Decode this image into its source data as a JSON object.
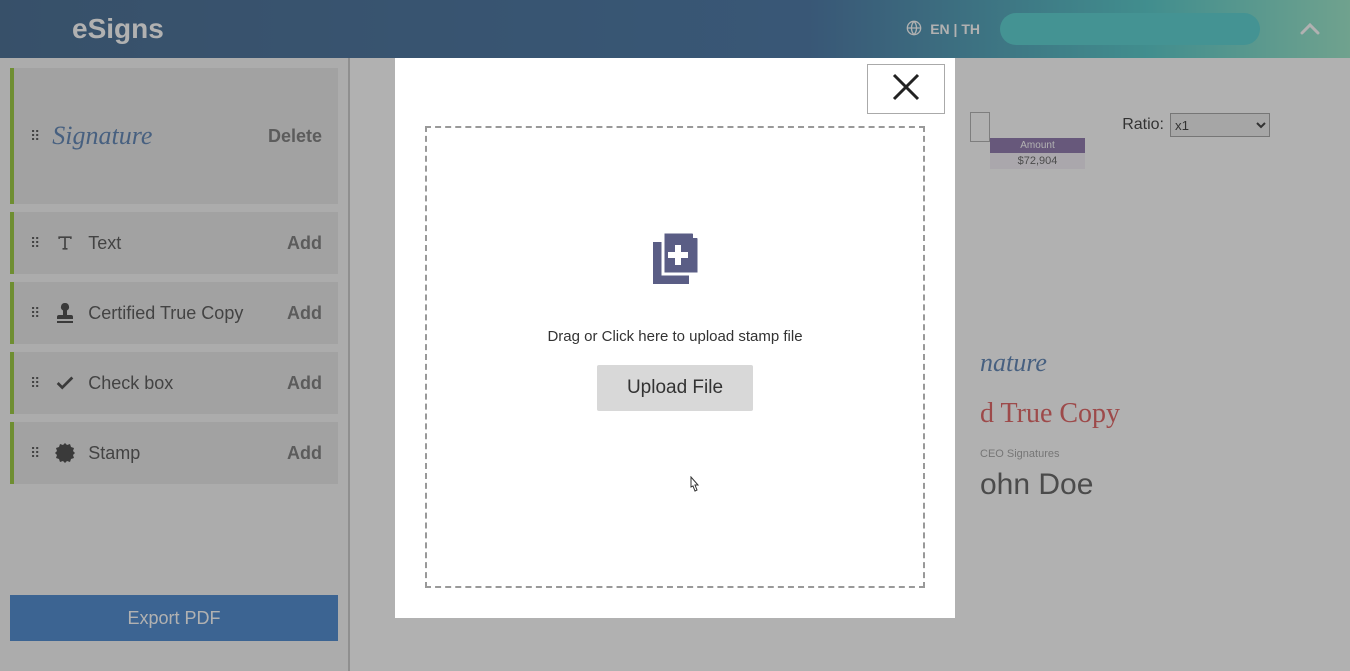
{
  "header": {
    "logo": "eSigns",
    "lang": "EN | TH"
  },
  "sidebar": {
    "items": [
      {
        "label": "Signature",
        "action": "Delete",
        "type": "signature"
      },
      {
        "label": "Text",
        "action": "Add",
        "type": "text"
      },
      {
        "label": "Certified True Copy",
        "action": "Add",
        "type": "ctc"
      },
      {
        "label": "Check box",
        "action": "Add",
        "type": "checkbox"
      },
      {
        "label": "Stamp",
        "action": "Add",
        "type": "stamp"
      }
    ],
    "export": "Export PDF"
  },
  "content": {
    "ratio_label": "Ratio:",
    "ratio_value": "x1",
    "table_head": "Amount",
    "table_cell": "$72,904",
    "sig": "nature",
    "ctc": "d True Copy",
    "ceo": "CEO Signatures",
    "name": "ohn Doe"
  },
  "modal": {
    "drop_text": "Drag or Click here to upload stamp file",
    "upload_btn": "Upload File"
  }
}
